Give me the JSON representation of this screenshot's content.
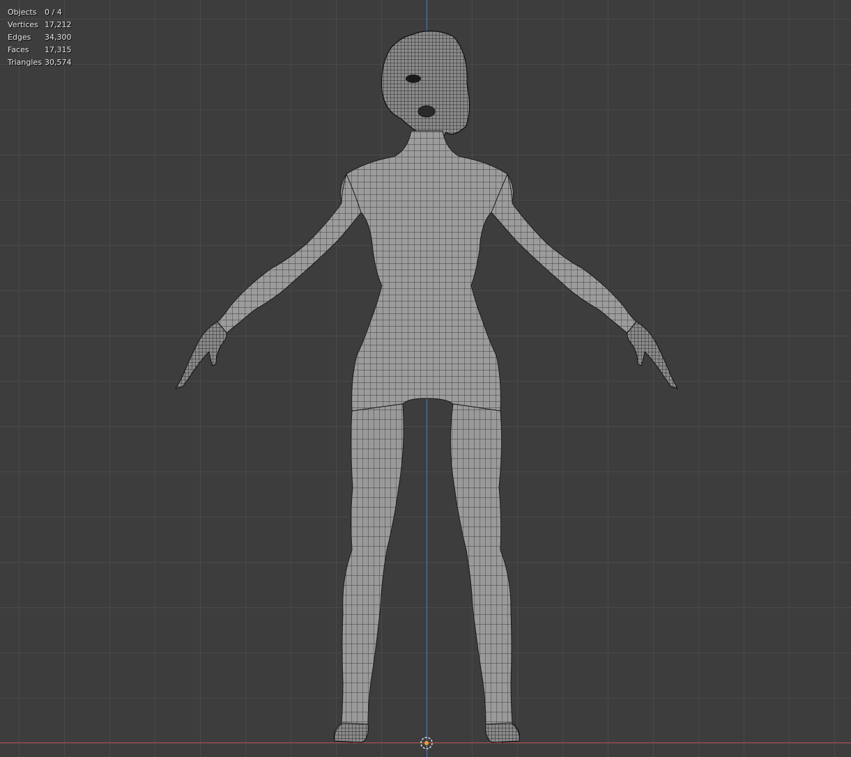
{
  "stats": [
    {
      "label": "Objects",
      "value": "0 / 4"
    },
    {
      "label": "Vertices",
      "value": "17,212"
    },
    {
      "label": "Edges",
      "value": "34,300"
    },
    {
      "label": "Faces",
      "value": "17,315"
    },
    {
      "label": "Triangles",
      "value": "30,574"
    }
  ],
  "colors": {
    "background": "#3d3d3d",
    "grid": "#4a4a4a",
    "axis_z": "#4f7bbd",
    "axis_x": "#b54a4a",
    "mesh_fill": "#9c9c9c",
    "wire": "#1e1e1e",
    "origin": "#e8a035"
  }
}
